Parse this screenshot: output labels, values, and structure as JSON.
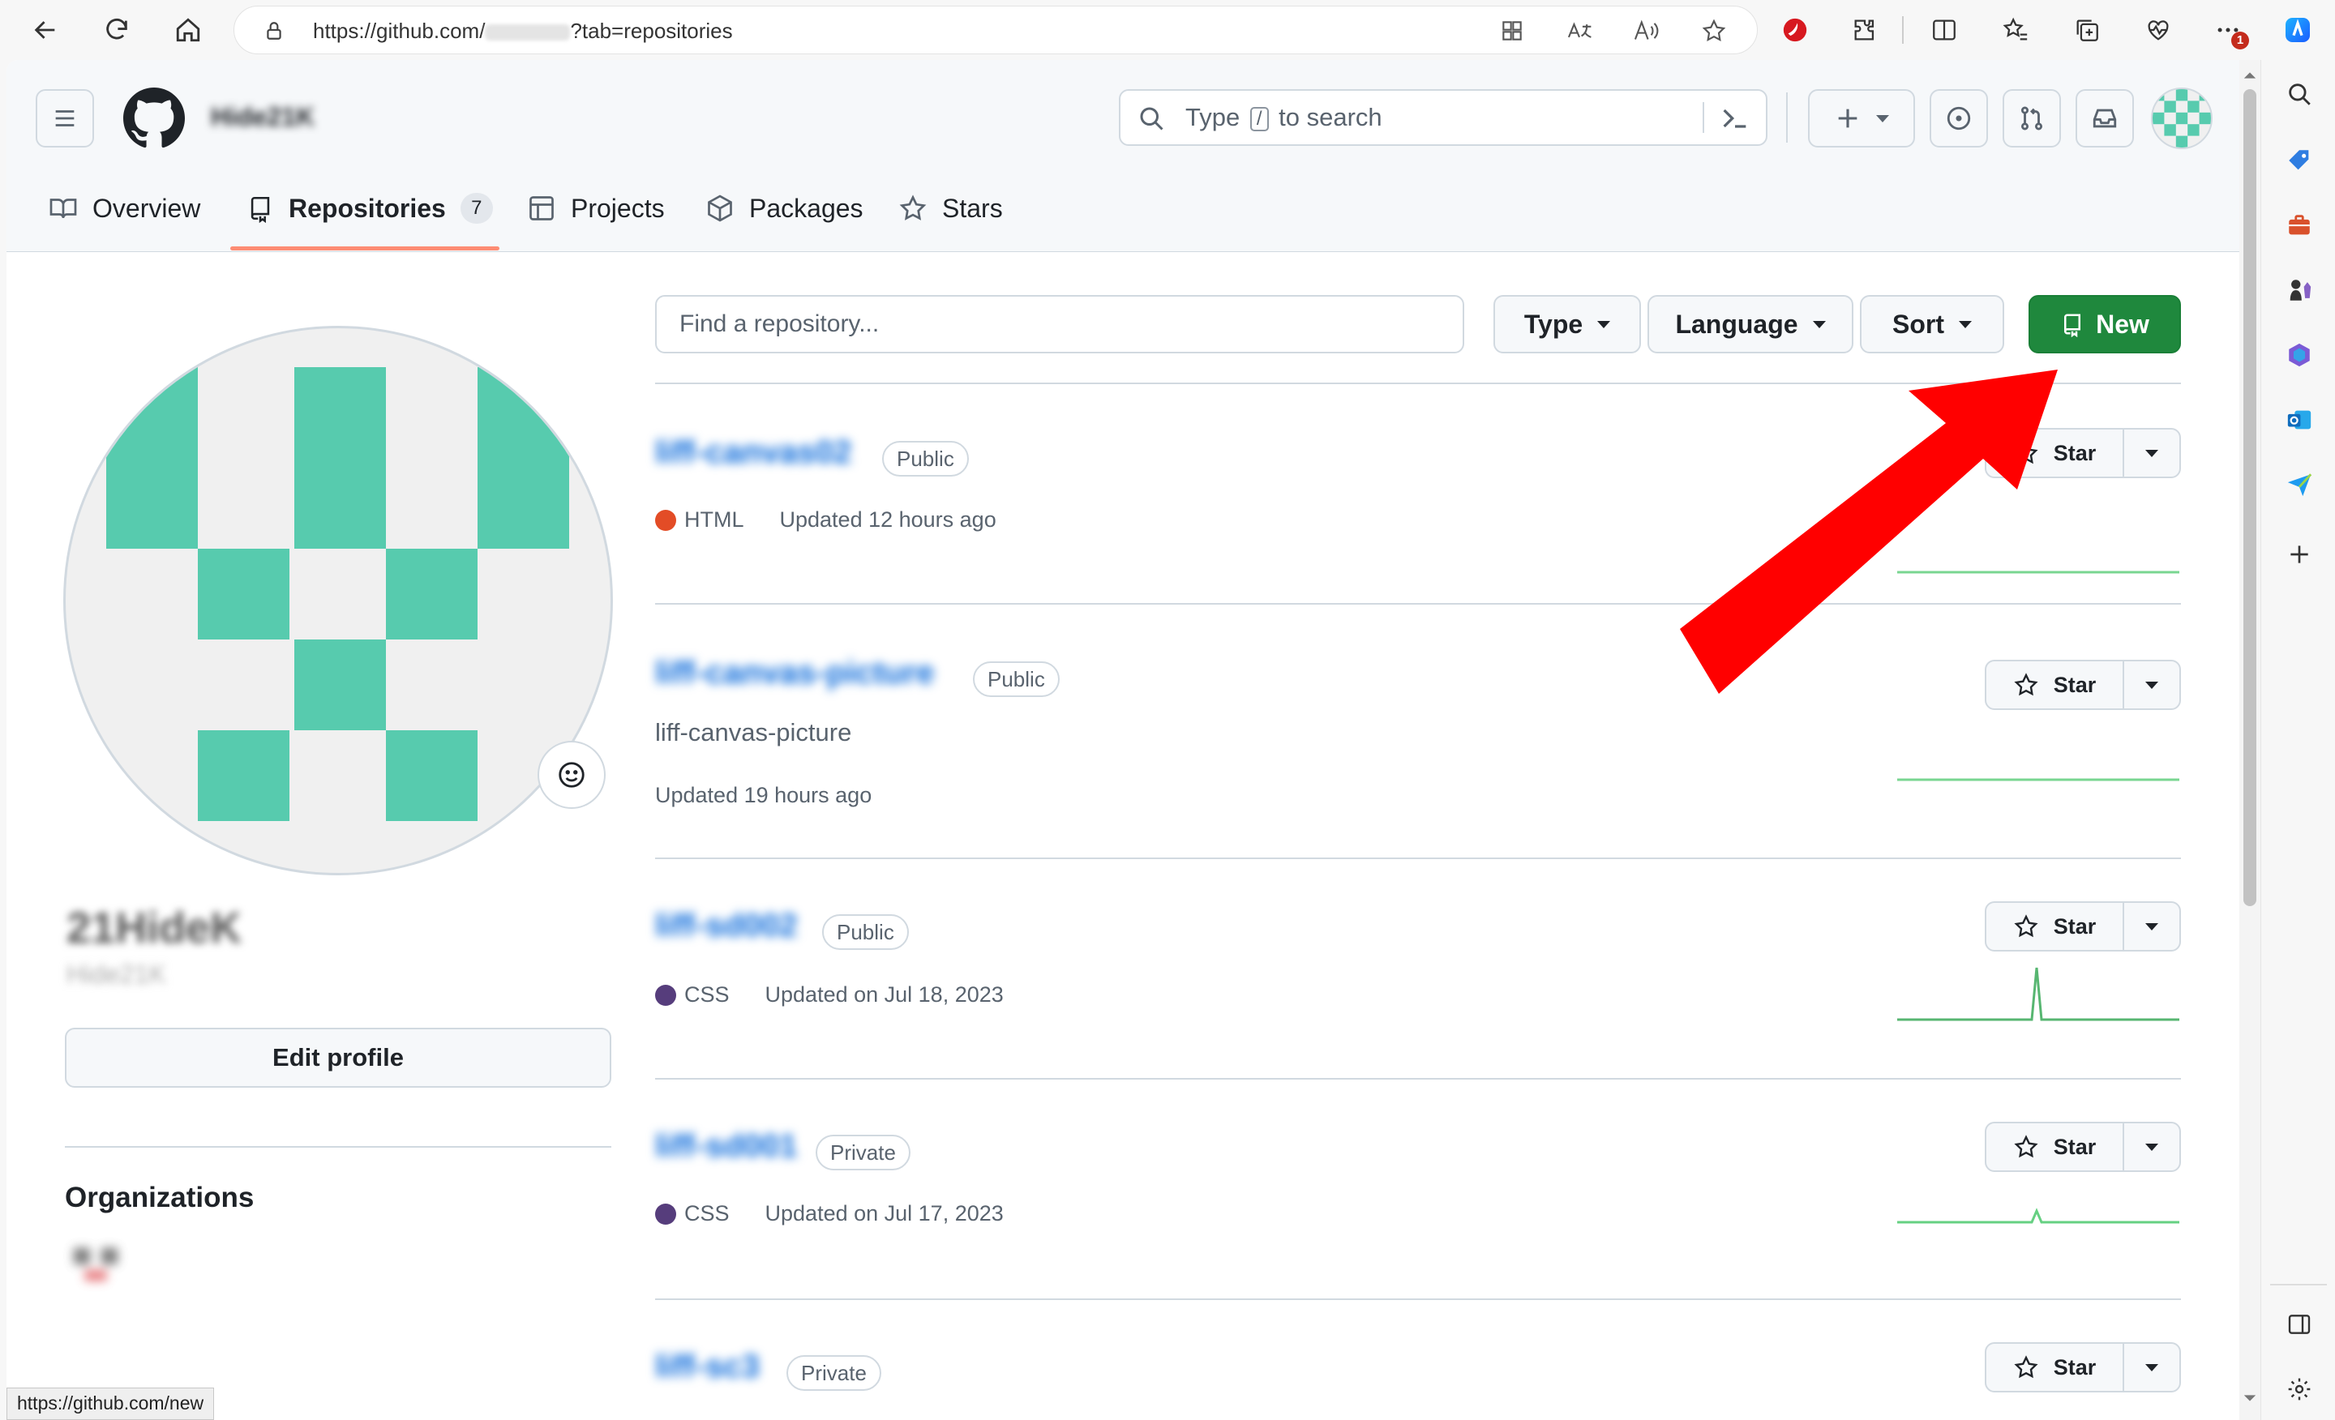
{
  "browser": {
    "url_prefix": "https://github.com/",
    "url_suffix": "?tab=repositories",
    "status_url": "https://github.com/new",
    "notification_count": "1"
  },
  "header": {
    "username": "Hide21K",
    "search_placeholder_before": "Type",
    "search_placeholder_key": "/",
    "search_placeholder_after": "to search"
  },
  "tabs": [
    {
      "label": "Overview",
      "icon": "book-icon"
    },
    {
      "label": "Repositories",
      "icon": "repo-icon",
      "count": "7"
    },
    {
      "label": "Projects",
      "icon": "table-icon"
    },
    {
      "label": "Packages",
      "icon": "package-icon"
    },
    {
      "label": "Stars",
      "icon": "star-icon"
    }
  ],
  "profile": {
    "display_name": "21HideK",
    "username": "Hide21K",
    "edit_label": "Edit profile",
    "organizations_title": "Organizations"
  },
  "filters": {
    "find_placeholder": "Find a repository...",
    "type_label": "Type",
    "language_label": "Language",
    "sort_label": "Sort",
    "new_label": "New"
  },
  "repos": [
    {
      "name": "liff-canvas02",
      "visibility": "Public",
      "language": "HTML",
      "language_color": "#e34c26",
      "description": "",
      "updated": "Updated 12 hours ago",
      "star_label": "Star"
    },
    {
      "name": "liff-canvas-picture",
      "visibility": "Public",
      "language": "",
      "language_color": "",
      "description": "liff-canvas-picture",
      "updated": "Updated 19 hours ago",
      "star_label": "Star"
    },
    {
      "name": "liff-sd002",
      "visibility": "Public",
      "language": "CSS",
      "language_color": "#563d7c",
      "description": "",
      "updated": "Updated on Jul 18, 2023",
      "star_label": "Star"
    },
    {
      "name": "liff-sd001",
      "visibility": "Private",
      "language": "CSS",
      "language_color": "#563d7c",
      "description": "",
      "updated": "Updated on Jul 17, 2023",
      "star_label": "Star"
    },
    {
      "name": "liff-sc3",
      "visibility": "Private",
      "language": "",
      "language_color": "",
      "description": "",
      "updated": "",
      "star_label": "Star"
    }
  ],
  "colors": {
    "accent_green": "#1f883d",
    "link_blue": "#0969da",
    "avatar_teal": "#57cbae",
    "annotation_arrow": "#ff0000"
  }
}
